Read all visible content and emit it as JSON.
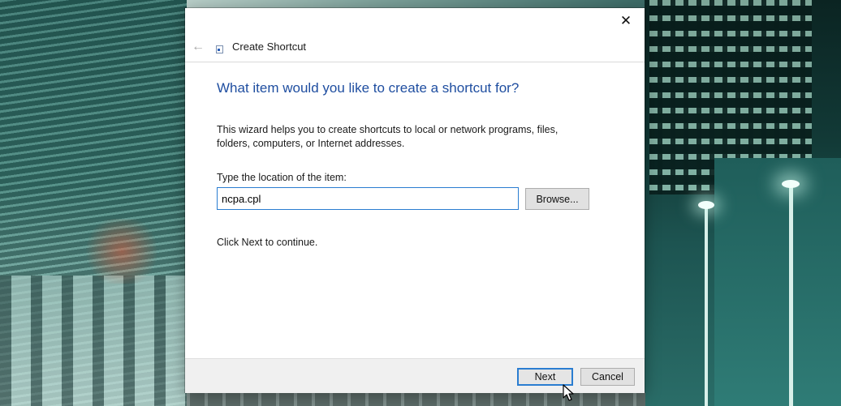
{
  "dialog": {
    "close_glyph": "✕",
    "back_glyph": "←",
    "wizard_title": "Create Shortcut",
    "heading": "What item would you like to create a shortcut for?",
    "description": "This wizard helps you to create shortcuts to local or network programs, files, folders, computers, or Internet addresses.",
    "location_label": "Type the location of the item:",
    "location_value": "ncpa.cpl",
    "browse_label": "Browse...",
    "hint": "Click Next to continue.",
    "next_label": "Next",
    "cancel_label": "Cancel"
  },
  "colors": {
    "heading": "#1f4ea0",
    "focus_border": "#2a7dd1",
    "button_face": "#e1e1e1",
    "footer_bg": "#f0f0f0"
  },
  "icons": {
    "close": "close-icon",
    "back": "back-arrow-icon",
    "wizard": "shortcut-wizard-icon",
    "cursor": "mouse-pointer-icon"
  }
}
